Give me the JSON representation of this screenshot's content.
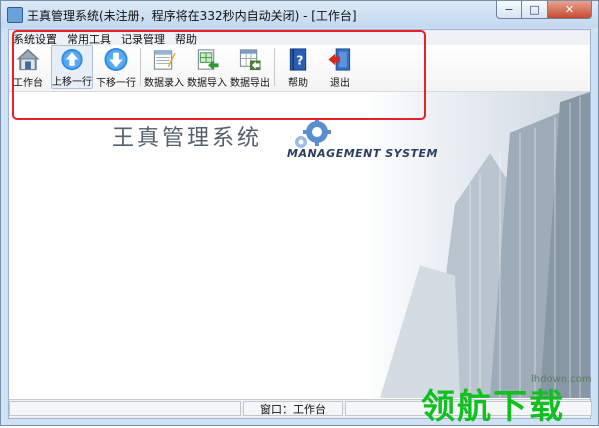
{
  "window": {
    "title": "王真管理系统(未注册，程序将在332秒内自动关闭) - [工作台]",
    "controls": {
      "minimize": "−",
      "maximize": "□",
      "close": "✕"
    }
  },
  "menubar": {
    "items": [
      "系统设置",
      "常用工具",
      "记录管理",
      "帮助"
    ]
  },
  "toolbar": {
    "items": [
      {
        "label": "工作台",
        "icon": "home-icon"
      },
      {
        "label": "上移一行",
        "icon": "arrow-up-icon"
      },
      {
        "label": "下移一行",
        "icon": "arrow-down-icon"
      },
      {
        "label": "数据录入",
        "icon": "data-entry-icon"
      },
      {
        "label": "数据导入",
        "icon": "data-import-icon"
      },
      {
        "label": "数据导出",
        "icon": "data-export-icon"
      },
      {
        "label": "帮助",
        "icon": "help-book-icon"
      },
      {
        "label": "退出",
        "icon": "exit-door-icon"
      }
    ]
  },
  "splash": {
    "title": "王真管理系统",
    "subtitle": "MANAGEMENT SYSTEM"
  },
  "statusbar": {
    "window_label": "窗口：工作台"
  },
  "watermark": {
    "cn": "领航下载",
    "url": "lhdown.com"
  },
  "colors": {
    "accent": "#1e7fd6",
    "highlight_box": "#e8202a",
    "watermark_green": "#11c01e"
  }
}
